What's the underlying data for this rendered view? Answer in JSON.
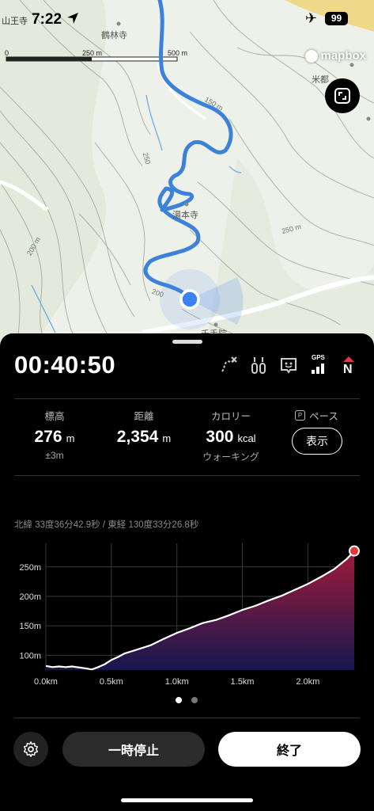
{
  "status_bar": {
    "time": "7:22",
    "battery": "99",
    "place_label": "山王寺"
  },
  "map": {
    "scale": {
      "left": "0",
      "mid": "250 m",
      "right": "500 m"
    },
    "poi": [
      {
        "name": "鶴林寺"
      },
      {
        "name": "米都"
      },
      {
        "name": "湯本寺"
      },
      {
        "name": "千手院"
      }
    ],
    "contour_labels": [
      "150 m",
      "200 m",
      "200",
      "250 m",
      "250"
    ],
    "attribution": "mapbox",
    "route_color": "#3b82d8",
    "location_color": "#3b82f6"
  },
  "activity": {
    "elapsed": "00:40:50",
    "status_icons": [
      "route-off-icon",
      "walking-poles-icon",
      "face-badge-icon",
      "gps-signal-icon",
      "north-up-icon"
    ],
    "gps_label": "GPS",
    "north_label": "N",
    "stats": {
      "elevation": {
        "label": "標高",
        "value": "276",
        "unit": "m",
        "sub": "±3m"
      },
      "distance": {
        "label": "距離",
        "value": "2,354",
        "unit": "m"
      },
      "calories": {
        "label": "カロリー",
        "value": "300",
        "unit": "kcal",
        "sub": "ウォーキング"
      },
      "pace": {
        "label": "ペース",
        "badge": "P",
        "button": "表示"
      }
    },
    "coordinates": "北緯 33度36分42.9秒 / 東経 130度33分26.8秒"
  },
  "chart_data": {
    "type": "area",
    "xlabel": "",
    "ylabel": "",
    "x_ticks": [
      "0.0km",
      "0.5km",
      "1.0km",
      "1.5km",
      "2.0km"
    ],
    "y_ticks": [
      "100m",
      "150m",
      "200m",
      "250m"
    ],
    "xlim": [
      0,
      2.354
    ],
    "ylim": [
      75,
      290
    ],
    "x": [
      0,
      0.05,
      0.1,
      0.15,
      0.2,
      0.3,
      0.35,
      0.4,
      0.45,
      0.5,
      0.55,
      0.6,
      0.7,
      0.8,
      0.9,
      1.0,
      1.1,
      1.2,
      1.3,
      1.4,
      1.5,
      1.6,
      1.7,
      1.8,
      1.9,
      2.0,
      2.1,
      2.2,
      2.3,
      2.354
    ],
    "y": [
      82,
      80,
      81,
      80,
      81,
      78,
      76,
      80,
      85,
      92,
      97,
      103,
      110,
      117,
      128,
      138,
      146,
      155,
      160,
      168,
      177,
      184,
      193,
      201,
      211,
      221,
      233,
      246,
      264,
      277
    ],
    "fill_top_color": "#a01a3a",
    "fill_bottom_color": "#15184f",
    "end_marker_color": "#e23a3a"
  },
  "controls": {
    "pause_label": "一時停止",
    "end_label": "終了"
  },
  "pager": {
    "count": 2,
    "active": 1
  }
}
